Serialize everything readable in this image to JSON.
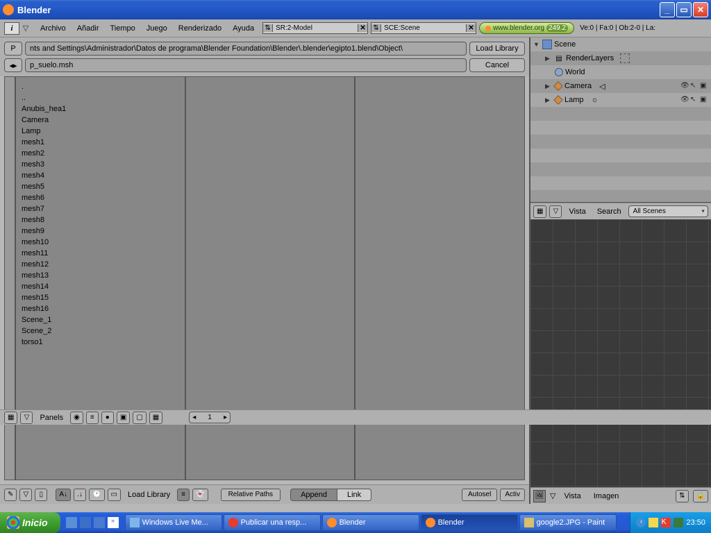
{
  "window": {
    "title": "Blender"
  },
  "menubar": {
    "items": [
      "Archivo",
      "Añadir",
      "Tiempo",
      "Juego",
      "Renderizado",
      "Ayuda"
    ],
    "screen_field": "SR:2-Model",
    "scene_field": "SCE:Scene",
    "url": "www.blender.org",
    "version": "249.2",
    "stats": "Ve:0 | Fa:0 | Ob:2-0 | La:"
  },
  "library": {
    "path": "nts and Settings\\Administrador\\Datos de programa\\Blender Foundation\\Blender\\.blender\\egipto1.blend\\Object\\",
    "file": "p_suelo.msh",
    "load_btn": "Load Library",
    "cancel_btn": "Cancel",
    "p_label": "P",
    "items": [
      ".",
      "..",
      "Anubis_hea1",
      "Camera",
      "Lamp",
      "mesh1",
      "mesh2",
      "mesh3",
      "mesh4",
      "mesh5",
      "mesh6",
      "mesh7",
      "mesh8",
      "mesh9",
      "mesh10",
      "mesh11",
      "mesh12",
      "mesh13",
      "mesh14",
      "mesh15",
      "mesh16",
      "Scene_1",
      "Scene_2",
      "torso1"
    ]
  },
  "fb_footer": {
    "load_label": "Load Library",
    "relpaths": "Relative Paths",
    "append": "Append",
    "link": "Link",
    "autosel": "Autosel",
    "active": "Activ"
  },
  "outliner": {
    "root": "Scene",
    "renderlayers": "RenderLayers",
    "world": "World",
    "camera": "Camera",
    "lamp": "Lamp"
  },
  "ol_footer": {
    "vista": "Vista",
    "search": "Search",
    "allscenes": "All Scenes"
  },
  "vp_footer": {
    "vista": "Vista",
    "imagen": "Imagen"
  },
  "btn_window": {
    "panels": "Panels",
    "page": "1"
  },
  "taskbar": {
    "start": "Inicio",
    "tasks": [
      {
        "label": "Windows Live Me...",
        "icon": "#7fb6ea"
      },
      {
        "label": "Publicar una resp...",
        "icon": "#e63b2d"
      },
      {
        "label": "Blender",
        "icon": "#ff8c2d"
      },
      {
        "label": "Blender",
        "icon": "#ff8c2d",
        "active": true
      },
      {
        "label": "google2.JPG - Paint",
        "icon": "#d9c06a"
      }
    ],
    "clock": "23:50"
  }
}
